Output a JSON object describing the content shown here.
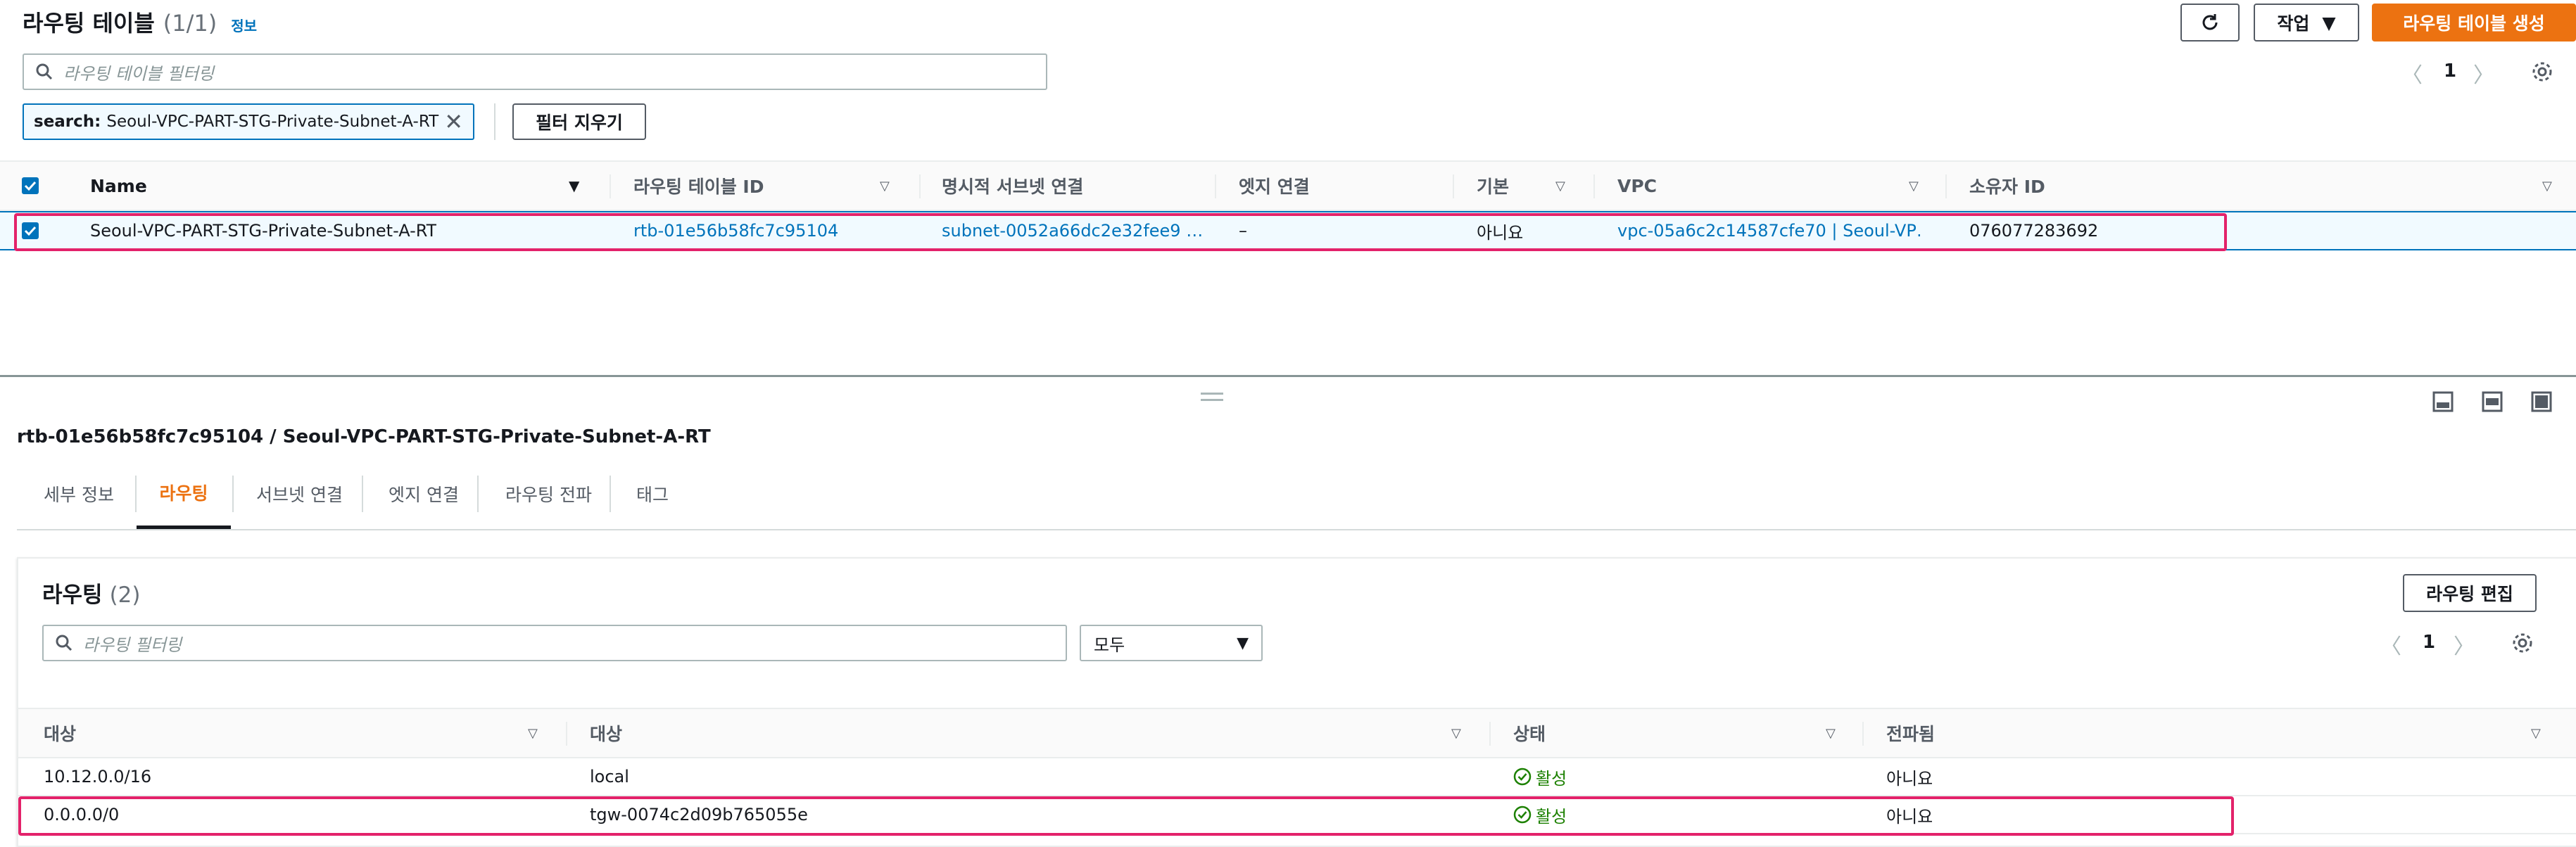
{
  "header": {
    "title": "라우팅 테이블",
    "count": "(1/1)",
    "info": "정보",
    "actions_label": "작업",
    "create_label": "라우팅 테이블 생성"
  },
  "filter": {
    "placeholder": "라우팅 테이블 필터링",
    "token_key": "search:",
    "token_value": "Seoul-VPC-PART-STG-Private-Subnet-A-RT",
    "clear_label": "필터 지우기"
  },
  "pagination": {
    "page": "1"
  },
  "table": {
    "columns": [
      "Name",
      "라우팅 테이블 ID",
      "명시적 서브넷 연결",
      "엣지 연결",
      "기본",
      "VPC",
      "소유자 ID"
    ],
    "row": {
      "name": "Seoul-VPC-PART-STG-Private-Subnet-A-RT",
      "rtb_id": "rtb-01e56b58fc7c95104",
      "subnet": "subnet-0052a66dc2e32fee9 …",
      "edge": "–",
      "main": "아니요",
      "vpc": "vpc-05a6c2c14587cfe70 | Seoul-VP…",
      "owner": "076077283692"
    }
  },
  "detail": {
    "title": "rtb-01e56b58fc7c95104 / Seoul-VPC-PART-STG-Private-Subnet-A-RT",
    "tabs": [
      "세부 정보",
      "라우팅",
      "서브넷 연결",
      "엣지 연결",
      "라우팅 전파",
      "태그"
    ],
    "active_tab": "라우팅"
  },
  "routes": {
    "title": "라우팅",
    "count": "(2)",
    "edit_label": "라우팅 편집",
    "filter_placeholder": "라우팅 필터링",
    "select_value": "모두",
    "page": "1",
    "columns": [
      "대상",
      "대상",
      "상태",
      "전파됨"
    ],
    "rows": [
      {
        "destination": "10.12.0.0/16",
        "target": "local",
        "status": "활성",
        "propagated": "아니요"
      },
      {
        "destination": "0.0.0.0/0",
        "target": "tgw-0074c2d09b765055e",
        "status": "활성",
        "propagated": "아니요"
      }
    ]
  },
  "colors": {
    "primary": "#ec7211",
    "link": "#0073bb",
    "highlight": "#e3226a",
    "success": "#1d8102",
    "selected_row": "#f1faff"
  }
}
